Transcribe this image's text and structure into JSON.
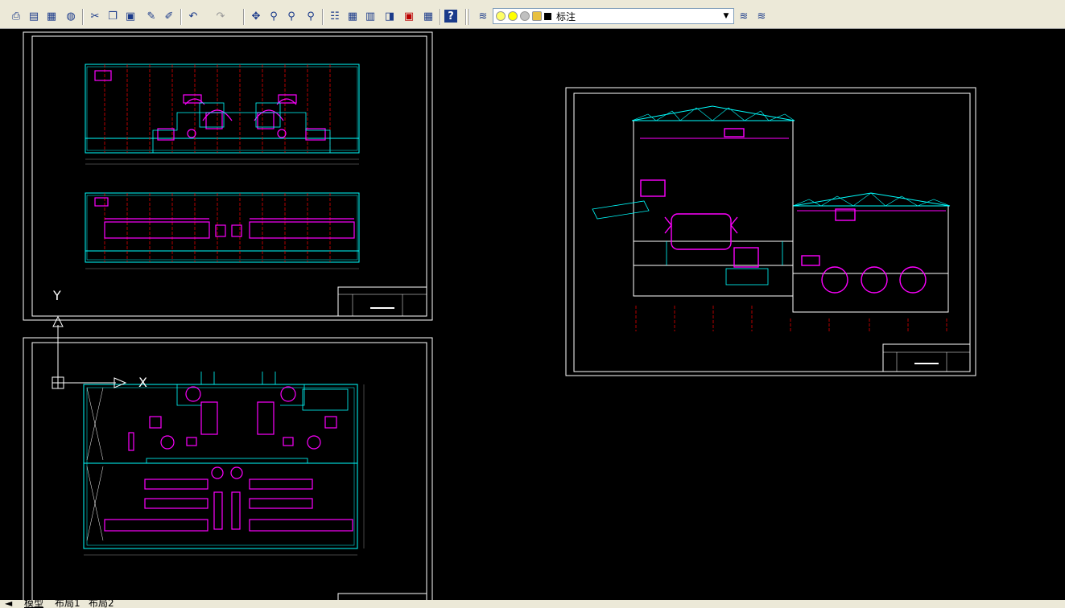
{
  "toolbar": {
    "buttons": [
      "print-icon",
      "print-preview-icon",
      "publish-icon",
      "3d-dwf-icon",
      "cut-icon",
      "copy-icon",
      "paste-icon",
      "match-properties-icon",
      "block-editor-icon",
      "undo-icon",
      "redo-icon",
      "pan-icon",
      "zoom-realtime-icon",
      "zoom-window-icon",
      "zoom-previous-icon",
      "properties-icon",
      "design-center-icon",
      "tool-palettes-icon",
      "sheet-set-icon",
      "markup-icon",
      "calculator-icon",
      "help-icon"
    ],
    "layer_manager_icon": "layer-manager-icon",
    "current_layer": "标注",
    "layer_prev_icon": "layer-previous-icon",
    "layer_state_icon": "layer-state-icon",
    "accent": "#ece9d8"
  },
  "canvas": {
    "background": "#000000",
    "ucs": {
      "y_label": "Y",
      "x_label": "X"
    }
  },
  "layout_tabs": [
    {
      "label": "模型",
      "active": true
    },
    {
      "label": "布局1",
      "active": false
    },
    {
      "label": "布局2",
      "active": false
    }
  ],
  "tab_nav": "◄"
}
